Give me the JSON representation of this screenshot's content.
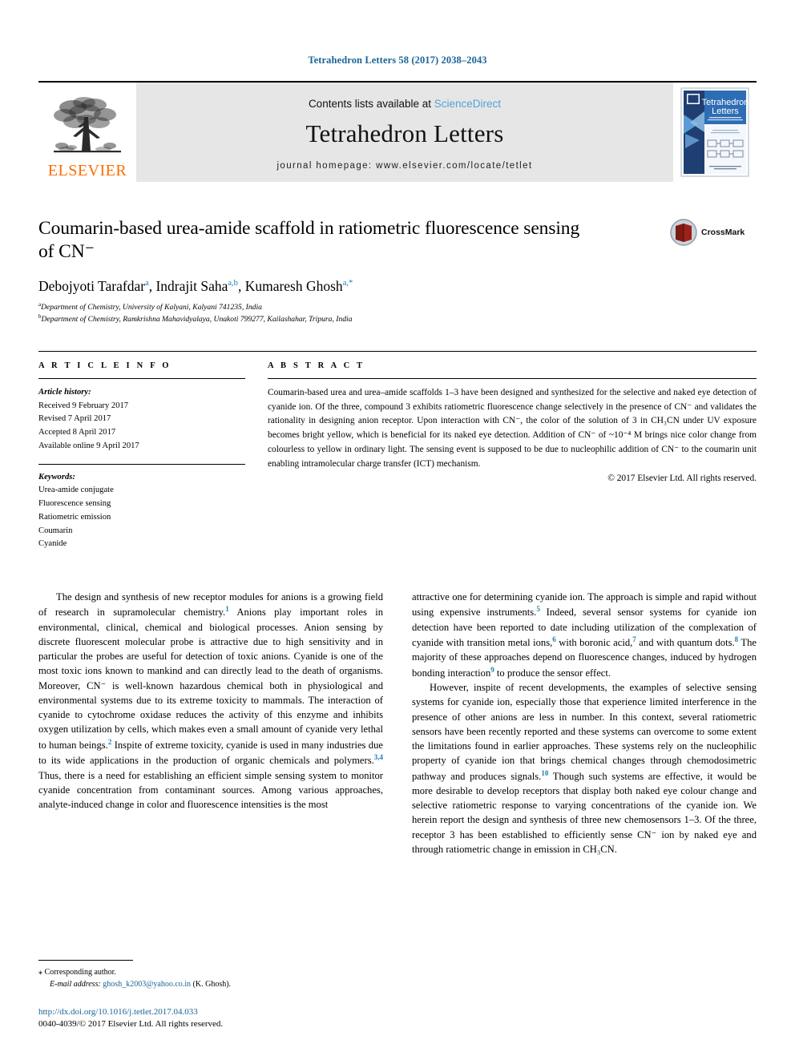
{
  "running_head": "Tetrahedron Letters 58 (2017) 2038–2043",
  "masthead": {
    "contents_prefix": "Contents lists available at ",
    "sciencedirect": "ScienceDirect",
    "journal_title": "Tetrahedron Letters",
    "homepage": "journal homepage: www.elsevier.com/locate/tetlet",
    "publisher": "ELSEVIER",
    "cover_title_line1": "Tetrahedron",
    "cover_title_line2": "Letters"
  },
  "article": {
    "title": "Coumarin-based urea-amide scaffold in ratiometric fluorescence sensing of CN⁻",
    "title_line1": "Coumarin-based urea-amide scaffold in ratiometric fluorescence sensing",
    "title_line2": "of CN⁻",
    "crossmark_label": "CrossMark",
    "authors_plain": "Debojyoti Tarafdar a, Indrajit Saha a,b, Kumaresh Ghosh a,*",
    "authors": [
      {
        "name": "Debojyoti Tarafdar",
        "sup": "a",
        "sep": ", "
      },
      {
        "name": "Indrajit Saha",
        "sup": "a,b",
        "sep": ", "
      },
      {
        "name": "Kumaresh Ghosh",
        "sup": "a,*",
        "sep": ""
      }
    ],
    "affiliations": [
      {
        "sup": "a",
        "text": "Department of Chemistry, University of Kalyani, Kalyani 741235, India"
      },
      {
        "sup": "b",
        "text": "Department of Chemistry, Ramkrishna Mahavidyalaya, Unakoti 799277, Kailashahar, Tripura, India"
      }
    ]
  },
  "article_info": {
    "heading": "A R T I C L E   I N F O",
    "history_label": "Article history:",
    "history": [
      "Received 9 February 2017",
      "Revised 7 April 2017",
      "Accepted 8 April 2017",
      "Available online 9 April 2017"
    ],
    "keywords_label": "Keywords:",
    "keywords": [
      "Urea-amide conjugate",
      "Fluorescence sensing",
      "Ratiometric emission",
      "Coumarin",
      "Cyanide"
    ]
  },
  "abstract": {
    "heading": "A B S T R A C T",
    "text": "Coumarin-based urea and urea–amide scaffolds 1–3 have been designed and synthesized for the selective and naked eye detection of cyanide ion. Of the three, compound 3 exhibits ratiometric fluorescence change selectively in the presence of CN⁻ and validates the rationality in designing anion receptor. Upon interaction with CN⁻, the color of the solution of 3 in CH₃CN under UV exposure becomes bright yellow, which is beneficial for its naked eye detection. Addition of CN⁻ of ~10⁻⁴ M brings nice color change from colourless to yellow in ordinary light. The sensing event is supposed to be due to nucleophilic addition of CN⁻ to the coumarin unit enabling intramolecular charge transfer (ICT) mechanism.",
    "copyright": "© 2017 Elsevier Ltd. All rights reserved."
  },
  "body": {
    "left_paragraph_1": "The design and synthesis of new receptor modules for anions is a growing field of research in supramolecular chemistry.",
    "left_ref_1": "1",
    "left_paragraph_1b": " Anions play important roles in environmental, clinical, chemical and biological processes. Anion sensing by discrete fluorescent molecular probe is attractive due to high sensitivity and in particular the probes are useful for detection of toxic anions. Cyanide is one of the most toxic ions known to mankind and can directly lead to the death of organisms. Moreover, CN⁻ is well-known hazardous chemical both in physiological and environmental systems due to its extreme toxicity to mammals. The interaction of cyanide to cytochrome oxidase reduces the activity of this enzyme and inhibits oxygen utilization by cells, which makes even a small amount of cyanide very lethal to human beings.",
    "left_ref_2": "2",
    "left_paragraph_1c": " Inspite of extreme toxicity, cyanide is used in many industries due to its wide applications in the production of organic chemicals and polymers.",
    "left_ref_3": "3,4",
    "left_paragraph_1d": " Thus, there is a need for establishing an efficient simple sensing system to monitor cyanide concentration from contaminant sources. Among various approaches, analyte-induced change in color and fluorescence intensities is the most",
    "right_paragraph_1a": "attractive one for determining cyanide ion. The approach is simple and rapid without using expensive instruments.",
    "right_ref_5": "5",
    "right_paragraph_1b": " Indeed, several sensor systems for cyanide ion detection have been reported to date including utilization of the complexation of cyanide with transition metal ions,",
    "right_ref_6": "6",
    "right_paragraph_1c": " with boronic acid,",
    "right_ref_7": "7",
    "right_paragraph_1d": " and with quantum dots.",
    "right_ref_8": "8",
    "right_paragraph_1e": " The majority of these approaches depend on fluorescence changes, induced by hydrogen bonding interaction",
    "right_ref_9": "9",
    "right_paragraph_1f": " to produce the sensor effect.",
    "right_paragraph_2a": "However, inspite of recent developments, the examples of selective sensing systems for cyanide ion, especially those that experience limited interference in the presence of other anions are less in number. In this context, several ratiometric sensors have been recently reported and these systems can overcome to some extent the limitations found in earlier approaches. These systems rely on the nucleophilic property of cyanide ion that brings chemical changes through chemodosimetric pathway and produces signals.",
    "right_ref_10": "10",
    "right_paragraph_2b": " Though such systems are effective, it would be more desirable to develop receptors that display both naked eye colour change and selective ratiometric response to varying concentrations of the cyanide ion. We herein report the design and synthesis of three new chemosensors 1–3. Of the three, receptor 3 has been established to efficiently sense CN⁻ ion by naked eye and through ratiometric change in emission in CH₃CN."
  },
  "footer": {
    "corresponding_star": "⁎",
    "corresponding_label": "Corresponding author.",
    "email_label": "E-mail address:",
    "email": "ghosh_k2003@yahoo.co.in",
    "email_attrib": "(K. Ghosh).",
    "doi": "http://dx.doi.org/10.1016/j.tetlet.2017.04.033",
    "issn_line": "0040-4039/© 2017 Elsevier Ltd. All rights reserved."
  },
  "colors": {
    "link": "#1a6496",
    "ref_blue": "#1a7fb5",
    "elsevier_orange": "#ff6c00",
    "masthead_gray": "#e6e6e6",
    "crossmark_red": "#9b2218"
  }
}
